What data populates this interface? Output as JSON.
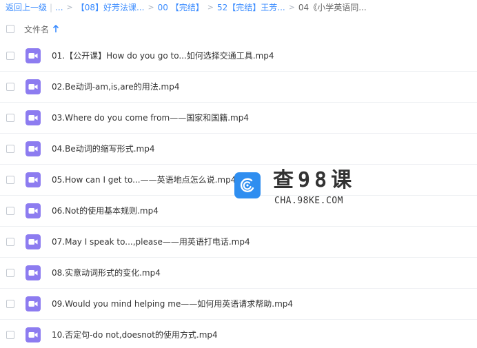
{
  "breadcrumb": {
    "back": "返回上一级",
    "ellipsis": "...",
    "items": [
      "【08】好芳法课...",
      "00 【完结】",
      "52【完结】王芳..."
    ],
    "current": "04《小学英语同..."
  },
  "header": {
    "column_label": "文件名"
  },
  "files": [
    "01.【公开课】How do you go to...如何选择交通工具.mp4",
    "02.Be动词-am,is,are的用法.mp4",
    "03.Where do you come from——国家和国籍.mp4",
    "04.Be动词的缩写形式.mp4",
    "05.How can I get to...——英语地点怎么说.mp4",
    "06.Not的使用基本规则.mp4",
    "07.May I speak to...,please——用英语打电话.mp4",
    "08.实意动词形式的变化.mp4",
    "09.Would you mind helping me——如何用英语请求帮助.mp4",
    "10.否定句-do not,doesnot的使用方式.mp4"
  ],
  "watermark": {
    "title": "查98课",
    "subtitle": "CHA.98KE.COM"
  },
  "colors": {
    "link": "#3b8cff",
    "video_icon": "#8d7cf0",
    "logo": "#2f8ef0"
  }
}
